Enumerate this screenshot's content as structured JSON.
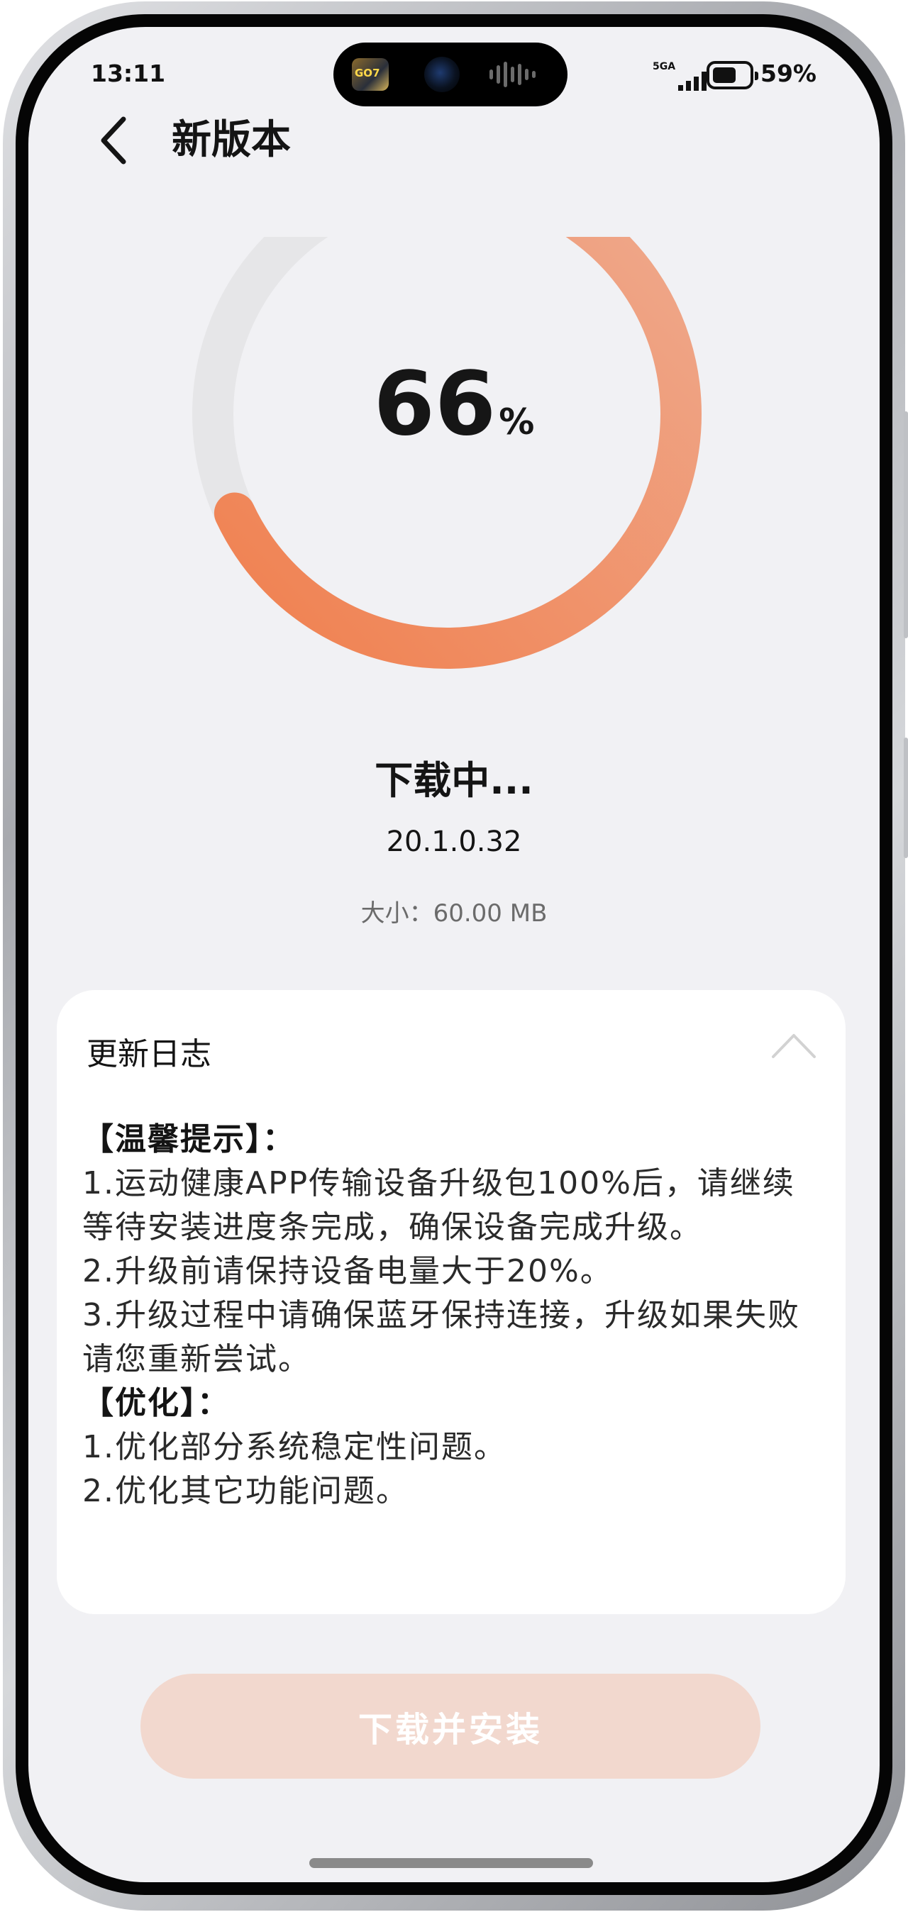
{
  "status_bar": {
    "time": "13:11",
    "network": "5GA",
    "battery_percent_text": "59%",
    "battery_level": 0.59,
    "island_app_label": "GO7"
  },
  "header": {
    "back_icon": "chevron-left-icon",
    "title": "新版本"
  },
  "progress": {
    "percent": 66,
    "percent_sign": "%",
    "fraction": 0.66,
    "gradient_start": "#F0804F",
    "gradient_end": "#EFAA8E",
    "track_color": "#E6E6E8"
  },
  "download": {
    "status": "下载中...",
    "version": "20.1.0.32",
    "size": "大小：60.00 MB"
  },
  "changelog": {
    "title": "更新日志",
    "toggle_icon": "chevron-up-icon",
    "section1_header": "【温馨提示】：",
    "item1": "1.运动健康APP传输设备升级包100%后，请继续等待安装进度条完成，确保设备完成升级。",
    "item2": "2.升级前请保持设备电量大于20%。",
    "item3": "3.升级过程中请确保蓝牙保持连接，升级如果失败请您重新尝试。",
    "section2_header": "【优化】：",
    "item4": "1.优化部分系统稳定性问题。",
    "item5": "2.优化其它功能问题。"
  },
  "install_button": {
    "label": "下载并安装",
    "color": "#F2D8CE"
  }
}
